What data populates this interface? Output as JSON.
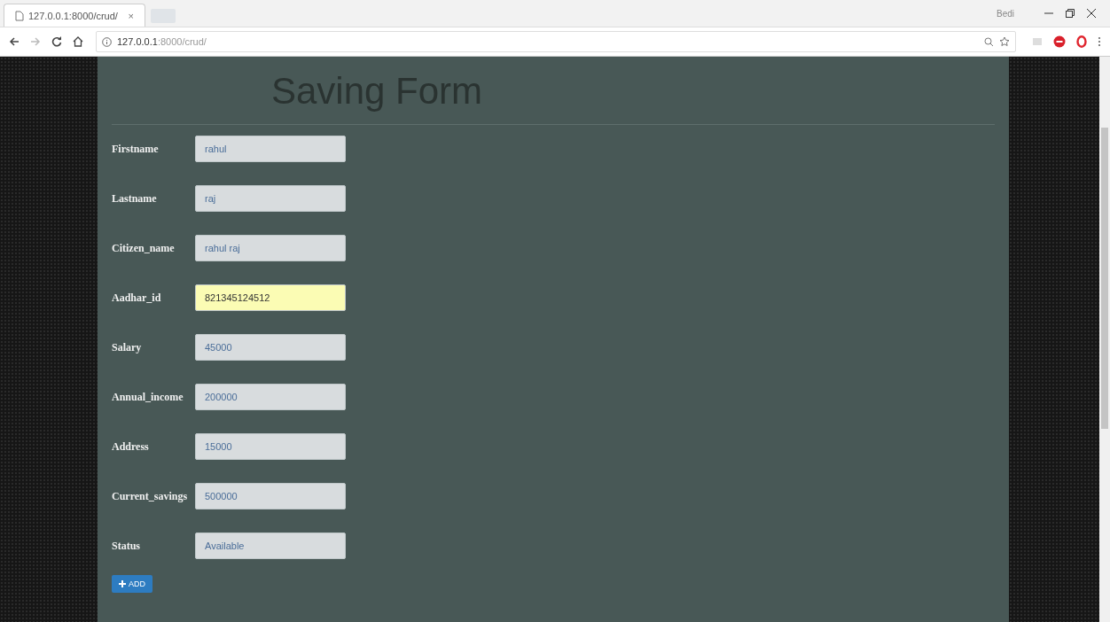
{
  "browser": {
    "tab_title": "127.0.0.1:8000/crud/",
    "tab_close": "×",
    "url_host": "127.0.0.1",
    "url_rest": ":8000/crud/",
    "profile": "Bedi"
  },
  "form": {
    "title": "Saving Form",
    "fields": [
      {
        "label": "Firstname",
        "value": "rahul",
        "autofilled": false
      },
      {
        "label": "Lastname",
        "value": "raj",
        "autofilled": false
      },
      {
        "label": "Citizen_name",
        "value": "rahul raj",
        "autofilled": false
      },
      {
        "label": "Aadhar_id",
        "value": "821345124512",
        "autofilled": true
      },
      {
        "label": "Salary",
        "value": "45000",
        "autofilled": false
      },
      {
        "label": "Annual_income",
        "value": "200000",
        "autofilled": false
      },
      {
        "label": "Address",
        "value": "15000",
        "autofilled": false
      },
      {
        "label": "Current_savings",
        "value": "500000",
        "autofilled": false
      },
      {
        "label": "Status",
        "value": "Available",
        "autofilled": false
      }
    ],
    "add_button": "ADD"
  }
}
